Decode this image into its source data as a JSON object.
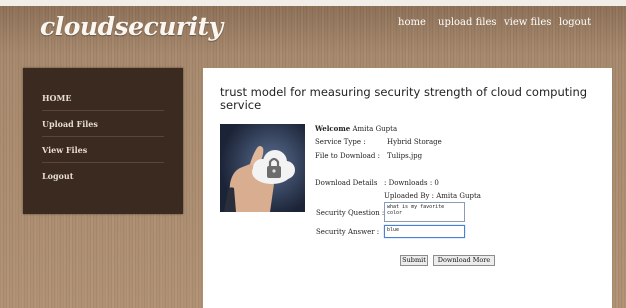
{
  "header": {
    "logo": "cloudsecurity",
    "nav": [
      "home",
      "upload files",
      "view files",
      "logout"
    ]
  },
  "sidebar": {
    "items": [
      "HOME",
      "Upload Files",
      "View Files",
      "Logout"
    ]
  },
  "main": {
    "heading": "trust model for measuring security strength of cloud computing service",
    "welcome_label": "Welcome",
    "user_name": "Amita Gupta",
    "service_type_label": "Service Type :",
    "service_type_value": "Hybrid Storage",
    "file_label": "File to Download :",
    "file_value": "Tulips.jpg",
    "download_details_label": "Download Details",
    "downloads_text": ": Downloads : 0",
    "uploaded_by_text": "Uploaded By : Amita Gupta",
    "question_label": "Security Question :",
    "question_value": "what is my favorite color",
    "answer_label": "Security Answer :",
    "answer_value": "blue",
    "submit_label": "Submit",
    "download_more_label": "Download More"
  },
  "colors": {
    "sidebar_bg": "#3b2a20",
    "page_bg": "#a7896d",
    "content_bg": "#ffffff"
  },
  "icons": [
    "padlock-cloud-photo"
  ]
}
